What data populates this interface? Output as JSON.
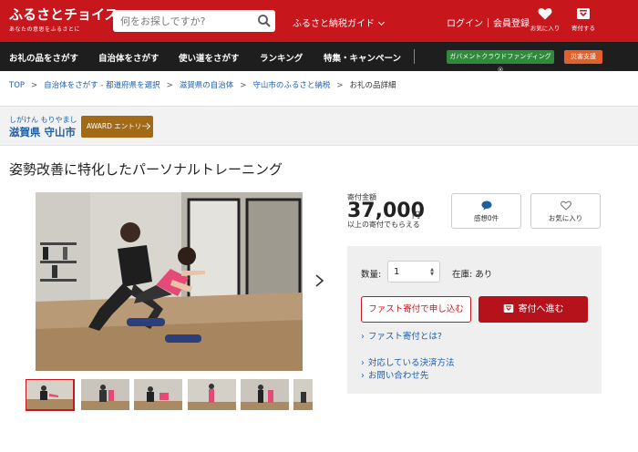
{
  "header": {
    "logo_main": "ふるさとチョイス",
    "logo_sub": "あなたの意思をふるさとに",
    "search_placeholder": "何をお探しですか?",
    "guide_label": "ふるさと納税ガイド",
    "login_label": "ログイン",
    "register_label": "会員登録",
    "favorites_label": "お気に入り",
    "donate_label": "寄付する"
  },
  "nav": {
    "items": [
      "お礼の品をさがす",
      "自治体をさがす",
      "使い道をさがす",
      "ランキング",
      "特集・キャンペーン"
    ],
    "gov_crowdfunding": "ガバメントクラウドファンディング®",
    "disaster_support": "災害支援"
  },
  "breadcrumb": {
    "items": [
      "TOP",
      "自治体をさがす - 都道府県を選択",
      "滋賀県の自治体",
      "守山市のふるさと納税"
    ],
    "current": "お礼の品詳細"
  },
  "municipality": {
    "kana": "しがけん もりやまし",
    "name": "滋賀県 守山市",
    "award_label": "AWARD エントリー"
  },
  "product": {
    "title": "姿勢改善に特化したパーソナルトレーニング",
    "amount_label": "寄付金額",
    "amount": "37,000",
    "amount_unit": "円",
    "amount_note": "以上の寄付でもらえる",
    "impressions_label": "感想0件",
    "favorite_label": "お気に入り",
    "quantity_label": "数量:",
    "quantity_value": "1",
    "stock_label": "在庫: あり",
    "fast_donate_button": "ファスト寄付で申し込む",
    "donate_button": "寄付へ進む",
    "fast_donate_link": "ファスト寄付とは?",
    "payment_link": "対応している決済方法",
    "contact_link": "お問い合わせ先"
  },
  "colors": {
    "brand_red": "#c8161d",
    "nav_dark": "#1e1e1e",
    "link_blue": "#1f5fa8",
    "award_brown": "#a26a16",
    "gov_green": "#2f8a3a",
    "disaster_orange": "#e2602b"
  },
  "icons": {
    "search": "search-icon",
    "heart": "heart-icon",
    "donate": "gift-box-icon",
    "comment": "speech-bubble-icon",
    "next": "chevron-right-icon"
  }
}
